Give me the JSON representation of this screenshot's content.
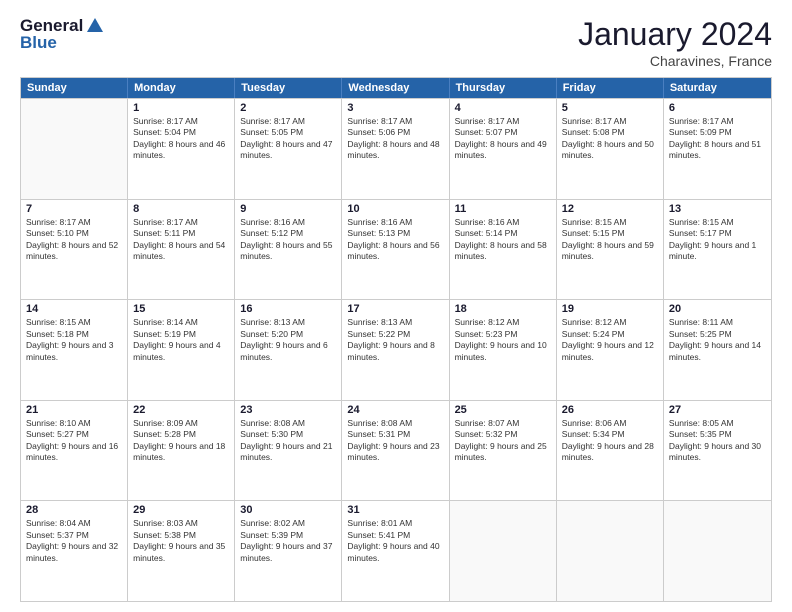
{
  "header": {
    "logo_general": "General",
    "logo_blue": "Blue",
    "month_title": "January 2024",
    "subtitle": "Charavines, France"
  },
  "days_of_week": [
    "Sunday",
    "Monday",
    "Tuesday",
    "Wednesday",
    "Thursday",
    "Friday",
    "Saturday"
  ],
  "weeks": [
    [
      {
        "day": "",
        "empty": true
      },
      {
        "day": "1",
        "sunrise": "Sunrise: 8:17 AM",
        "sunset": "Sunset: 5:04 PM",
        "daylight": "Daylight: 8 hours and 46 minutes."
      },
      {
        "day": "2",
        "sunrise": "Sunrise: 8:17 AM",
        "sunset": "Sunset: 5:05 PM",
        "daylight": "Daylight: 8 hours and 47 minutes."
      },
      {
        "day": "3",
        "sunrise": "Sunrise: 8:17 AM",
        "sunset": "Sunset: 5:06 PM",
        "daylight": "Daylight: 8 hours and 48 minutes."
      },
      {
        "day": "4",
        "sunrise": "Sunrise: 8:17 AM",
        "sunset": "Sunset: 5:07 PM",
        "daylight": "Daylight: 8 hours and 49 minutes."
      },
      {
        "day": "5",
        "sunrise": "Sunrise: 8:17 AM",
        "sunset": "Sunset: 5:08 PM",
        "daylight": "Daylight: 8 hours and 50 minutes."
      },
      {
        "day": "6",
        "sunrise": "Sunrise: 8:17 AM",
        "sunset": "Sunset: 5:09 PM",
        "daylight": "Daylight: 8 hours and 51 minutes."
      }
    ],
    [
      {
        "day": "7",
        "sunrise": "Sunrise: 8:17 AM",
        "sunset": "Sunset: 5:10 PM",
        "daylight": "Daylight: 8 hours and 52 minutes."
      },
      {
        "day": "8",
        "sunrise": "Sunrise: 8:17 AM",
        "sunset": "Sunset: 5:11 PM",
        "daylight": "Daylight: 8 hours and 54 minutes."
      },
      {
        "day": "9",
        "sunrise": "Sunrise: 8:16 AM",
        "sunset": "Sunset: 5:12 PM",
        "daylight": "Daylight: 8 hours and 55 minutes."
      },
      {
        "day": "10",
        "sunrise": "Sunrise: 8:16 AM",
        "sunset": "Sunset: 5:13 PM",
        "daylight": "Daylight: 8 hours and 56 minutes."
      },
      {
        "day": "11",
        "sunrise": "Sunrise: 8:16 AM",
        "sunset": "Sunset: 5:14 PM",
        "daylight": "Daylight: 8 hours and 58 minutes."
      },
      {
        "day": "12",
        "sunrise": "Sunrise: 8:15 AM",
        "sunset": "Sunset: 5:15 PM",
        "daylight": "Daylight: 8 hours and 59 minutes."
      },
      {
        "day": "13",
        "sunrise": "Sunrise: 8:15 AM",
        "sunset": "Sunset: 5:17 PM",
        "daylight": "Daylight: 9 hours and 1 minute."
      }
    ],
    [
      {
        "day": "14",
        "sunrise": "Sunrise: 8:15 AM",
        "sunset": "Sunset: 5:18 PM",
        "daylight": "Daylight: 9 hours and 3 minutes."
      },
      {
        "day": "15",
        "sunrise": "Sunrise: 8:14 AM",
        "sunset": "Sunset: 5:19 PM",
        "daylight": "Daylight: 9 hours and 4 minutes."
      },
      {
        "day": "16",
        "sunrise": "Sunrise: 8:13 AM",
        "sunset": "Sunset: 5:20 PM",
        "daylight": "Daylight: 9 hours and 6 minutes."
      },
      {
        "day": "17",
        "sunrise": "Sunrise: 8:13 AM",
        "sunset": "Sunset: 5:22 PM",
        "daylight": "Daylight: 9 hours and 8 minutes."
      },
      {
        "day": "18",
        "sunrise": "Sunrise: 8:12 AM",
        "sunset": "Sunset: 5:23 PM",
        "daylight": "Daylight: 9 hours and 10 minutes."
      },
      {
        "day": "19",
        "sunrise": "Sunrise: 8:12 AM",
        "sunset": "Sunset: 5:24 PM",
        "daylight": "Daylight: 9 hours and 12 minutes."
      },
      {
        "day": "20",
        "sunrise": "Sunrise: 8:11 AM",
        "sunset": "Sunset: 5:25 PM",
        "daylight": "Daylight: 9 hours and 14 minutes."
      }
    ],
    [
      {
        "day": "21",
        "sunrise": "Sunrise: 8:10 AM",
        "sunset": "Sunset: 5:27 PM",
        "daylight": "Daylight: 9 hours and 16 minutes."
      },
      {
        "day": "22",
        "sunrise": "Sunrise: 8:09 AM",
        "sunset": "Sunset: 5:28 PM",
        "daylight": "Daylight: 9 hours and 18 minutes."
      },
      {
        "day": "23",
        "sunrise": "Sunrise: 8:08 AM",
        "sunset": "Sunset: 5:30 PM",
        "daylight": "Daylight: 9 hours and 21 minutes."
      },
      {
        "day": "24",
        "sunrise": "Sunrise: 8:08 AM",
        "sunset": "Sunset: 5:31 PM",
        "daylight": "Daylight: 9 hours and 23 minutes."
      },
      {
        "day": "25",
        "sunrise": "Sunrise: 8:07 AM",
        "sunset": "Sunset: 5:32 PM",
        "daylight": "Daylight: 9 hours and 25 minutes."
      },
      {
        "day": "26",
        "sunrise": "Sunrise: 8:06 AM",
        "sunset": "Sunset: 5:34 PM",
        "daylight": "Daylight: 9 hours and 28 minutes."
      },
      {
        "day": "27",
        "sunrise": "Sunrise: 8:05 AM",
        "sunset": "Sunset: 5:35 PM",
        "daylight": "Daylight: 9 hours and 30 minutes."
      }
    ],
    [
      {
        "day": "28",
        "sunrise": "Sunrise: 8:04 AM",
        "sunset": "Sunset: 5:37 PM",
        "daylight": "Daylight: 9 hours and 32 minutes."
      },
      {
        "day": "29",
        "sunrise": "Sunrise: 8:03 AM",
        "sunset": "Sunset: 5:38 PM",
        "daylight": "Daylight: 9 hours and 35 minutes."
      },
      {
        "day": "30",
        "sunrise": "Sunrise: 8:02 AM",
        "sunset": "Sunset: 5:39 PM",
        "daylight": "Daylight: 9 hours and 37 minutes."
      },
      {
        "day": "31",
        "sunrise": "Sunrise: 8:01 AM",
        "sunset": "Sunset: 5:41 PM",
        "daylight": "Daylight: 9 hours and 40 minutes."
      },
      {
        "day": "",
        "empty": true
      },
      {
        "day": "",
        "empty": true
      },
      {
        "day": "",
        "empty": true
      }
    ]
  ]
}
